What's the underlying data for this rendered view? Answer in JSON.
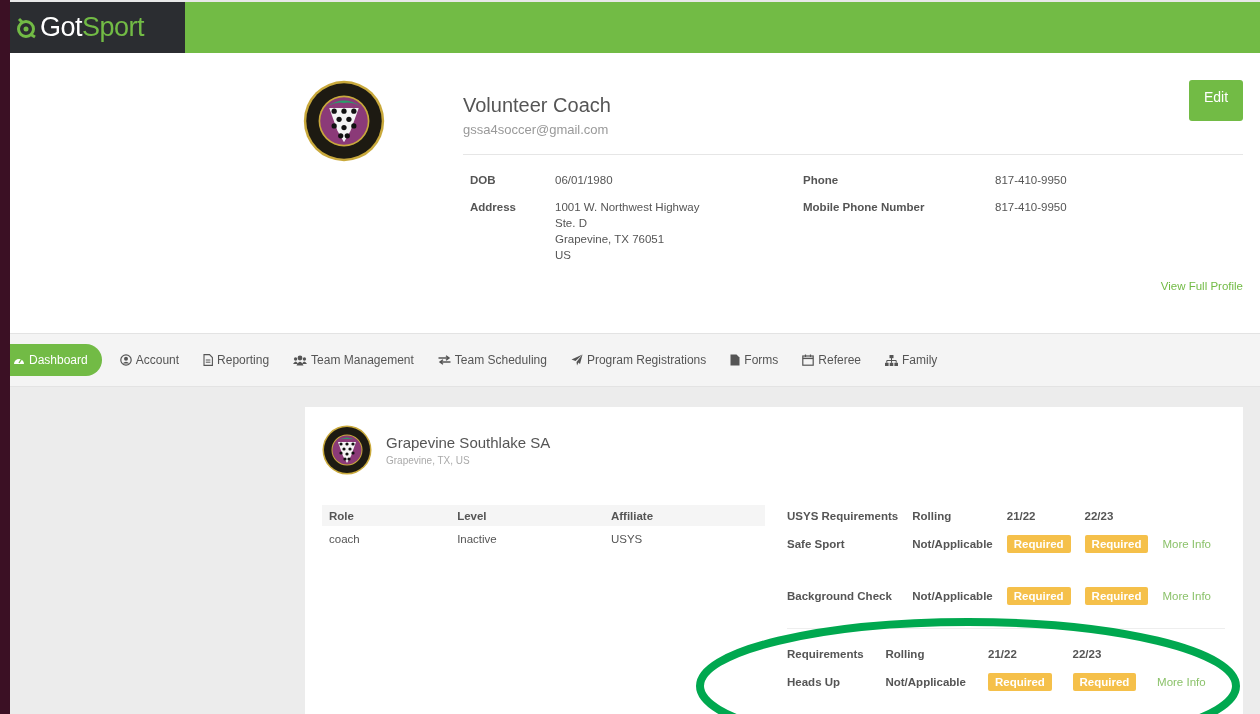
{
  "header": {
    "logo": {
      "prefix": "Got",
      "suffix": "Sport"
    }
  },
  "profile": {
    "name": "Volunteer Coach",
    "email": "gssa4soccer@gmail.com",
    "edit_button": "Edit",
    "details": [
      {
        "label": "DOB",
        "lines": [
          "06/01/1980"
        ]
      },
      {
        "label": "Phone",
        "lines": [
          "817-410-9950"
        ]
      },
      {
        "label": "Address",
        "lines": [
          "1001 W. Northwest Highway",
          "Ste. D",
          "Grapevine, TX 76051",
          "US"
        ]
      },
      {
        "label": "Mobile Phone Number",
        "lines": [
          "817-410-9950"
        ]
      }
    ],
    "view_full_profile": "View Full Profile"
  },
  "nav": [
    {
      "label": "Dashboard",
      "kind": "dashboard",
      "selected": true
    },
    {
      "label": "Account",
      "kind": "account",
      "selected": false
    },
    {
      "label": "Reporting",
      "kind": "document",
      "selected": false
    },
    {
      "label": "Team Management",
      "kind": "users",
      "selected": false
    },
    {
      "label": "Team Scheduling",
      "kind": "exchange",
      "selected": false
    },
    {
      "label": "Program Registrations",
      "kind": "send",
      "selected": false
    },
    {
      "label": "Forms",
      "kind": "file",
      "selected": false
    },
    {
      "label": "Referee",
      "kind": "calendar",
      "selected": false
    },
    {
      "label": "Family",
      "kind": "sitemap",
      "selected": false
    }
  ],
  "organization": {
    "name": "Grapevine Southlake SA",
    "location": "Grapevine, TX, US",
    "roles_table": {
      "columns": [
        "Role",
        "Level",
        "Affiliate"
      ],
      "rows": [
        [
          "coach",
          "Inactive",
          "USYS"
        ]
      ]
    },
    "requirement_groups": [
      {
        "columns": [
          "USYS Requirements",
          "Rolling",
          "21/22",
          "22/23"
        ],
        "rows": [
          {
            "name": "Safe Sport",
            "rolling": "Not/Applicable",
            "seasons": [
              "Required",
              "Required"
            ],
            "link": "More Info"
          },
          {
            "name": "Background Check",
            "rolling": "Not/Applicable",
            "seasons": [
              "Required",
              "Required"
            ],
            "link": "More Info"
          }
        ]
      },
      {
        "columns": [
          "Requirements",
          "Rolling",
          "21/22",
          "22/23"
        ],
        "rows": [
          {
            "name": "Heads Up",
            "rolling": "Not/Applicable",
            "seasons": [
              "Required",
              "Required"
            ],
            "link": "More Info"
          }
        ]
      }
    ]
  }
}
